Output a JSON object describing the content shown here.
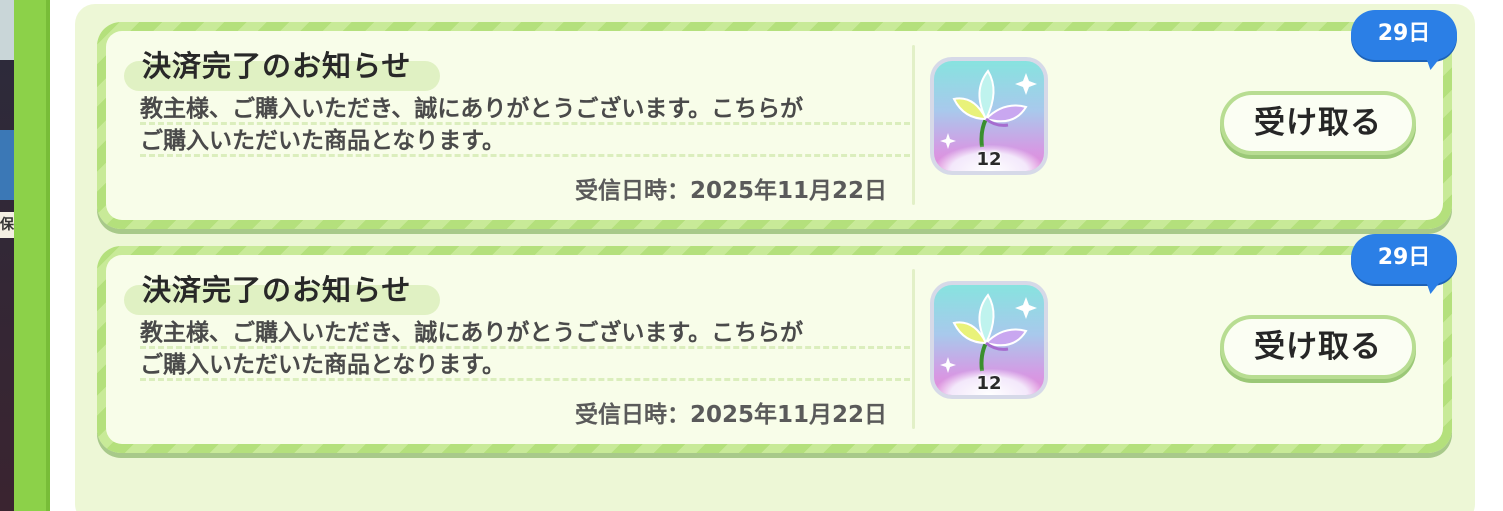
{
  "mails": [
    {
      "title": "決済完了のお知らせ",
      "body_lines": [
        "教主様、ご購入いただき、誠にありがとうございます。こちらが",
        "ご購入いただいた商品となります。"
      ],
      "received": "受信日時：2025年11月22日",
      "reward": {
        "icon": "crystal-flower-icon",
        "count": "12"
      },
      "receive_label": "受け取る",
      "days_left": "29日"
    },
    {
      "title": "決済完了のお知らせ",
      "body_lines": [
        "教主様、ご購入いただき、誠にありがとうございます。こちらが",
        "ご購入いただいた商品となります。"
      ],
      "received": "受信日時：2025年11月22日",
      "reward": {
        "icon": "crystal-flower-icon",
        "count": "12"
      },
      "receive_label": "受け取る",
      "days_left": "29日"
    }
  ],
  "colors": {
    "rail_green": "#8cd149",
    "panel_bg": "#edf7d6",
    "card_border": "#b4e07c",
    "badge_blue": "#2b7fe6"
  }
}
